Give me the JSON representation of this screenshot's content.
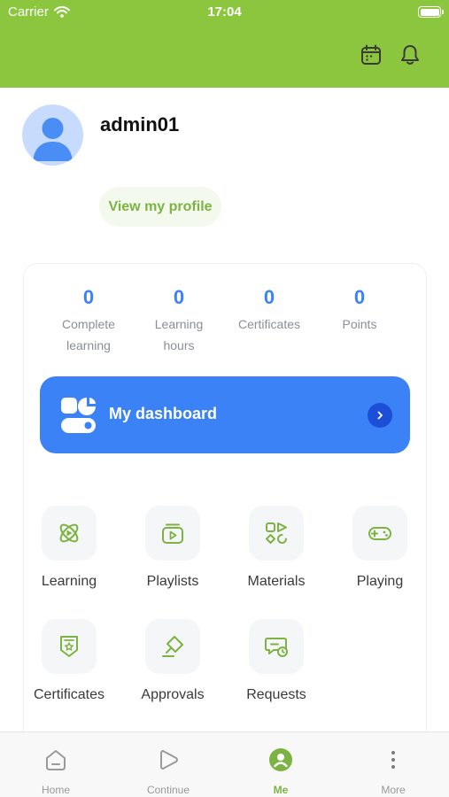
{
  "colors": {
    "brand": "#8cc63f",
    "accent_blue": "#3b82f6",
    "active_tab": "#7cb342"
  },
  "status_bar": {
    "carrier": "Carrier",
    "time": "17:04"
  },
  "header": {
    "icons": [
      "calendar-icon",
      "bell-icon"
    ]
  },
  "profile": {
    "username": "admin01",
    "view_profile_label": "View my profile"
  },
  "stats": [
    {
      "value": "0",
      "label_line1": "Complete",
      "label_line2": "learning"
    },
    {
      "value": "0",
      "label_line1": "Learning",
      "label_line2": "hours"
    },
    {
      "value": "0",
      "label_line1": "Certificates",
      "label_line2": ""
    },
    {
      "value": "0",
      "label_line1": "Points",
      "label_line2": ""
    }
  ],
  "dashboard": {
    "label": "My dashboard"
  },
  "menu": [
    {
      "label": "Learning",
      "icon": "atom-icon"
    },
    {
      "label": "Playlists",
      "icon": "playlist-icon"
    },
    {
      "label": "Materials",
      "icon": "shapes-icon"
    },
    {
      "label": "Playing",
      "icon": "gamepad-icon"
    },
    {
      "label": "Certificates",
      "icon": "badge-icon"
    },
    {
      "label": "Approvals",
      "icon": "stamp-icon"
    },
    {
      "label": "Requests",
      "icon": "chat-clock-icon"
    }
  ],
  "tabbar": {
    "tabs": [
      {
        "label": "Home",
        "icon": "home-icon"
      },
      {
        "label": "Continue",
        "icon": "play-icon"
      },
      {
        "label": "Me",
        "icon": "user-icon",
        "active": true
      },
      {
        "label": "More",
        "icon": "more-icon"
      }
    ]
  }
}
